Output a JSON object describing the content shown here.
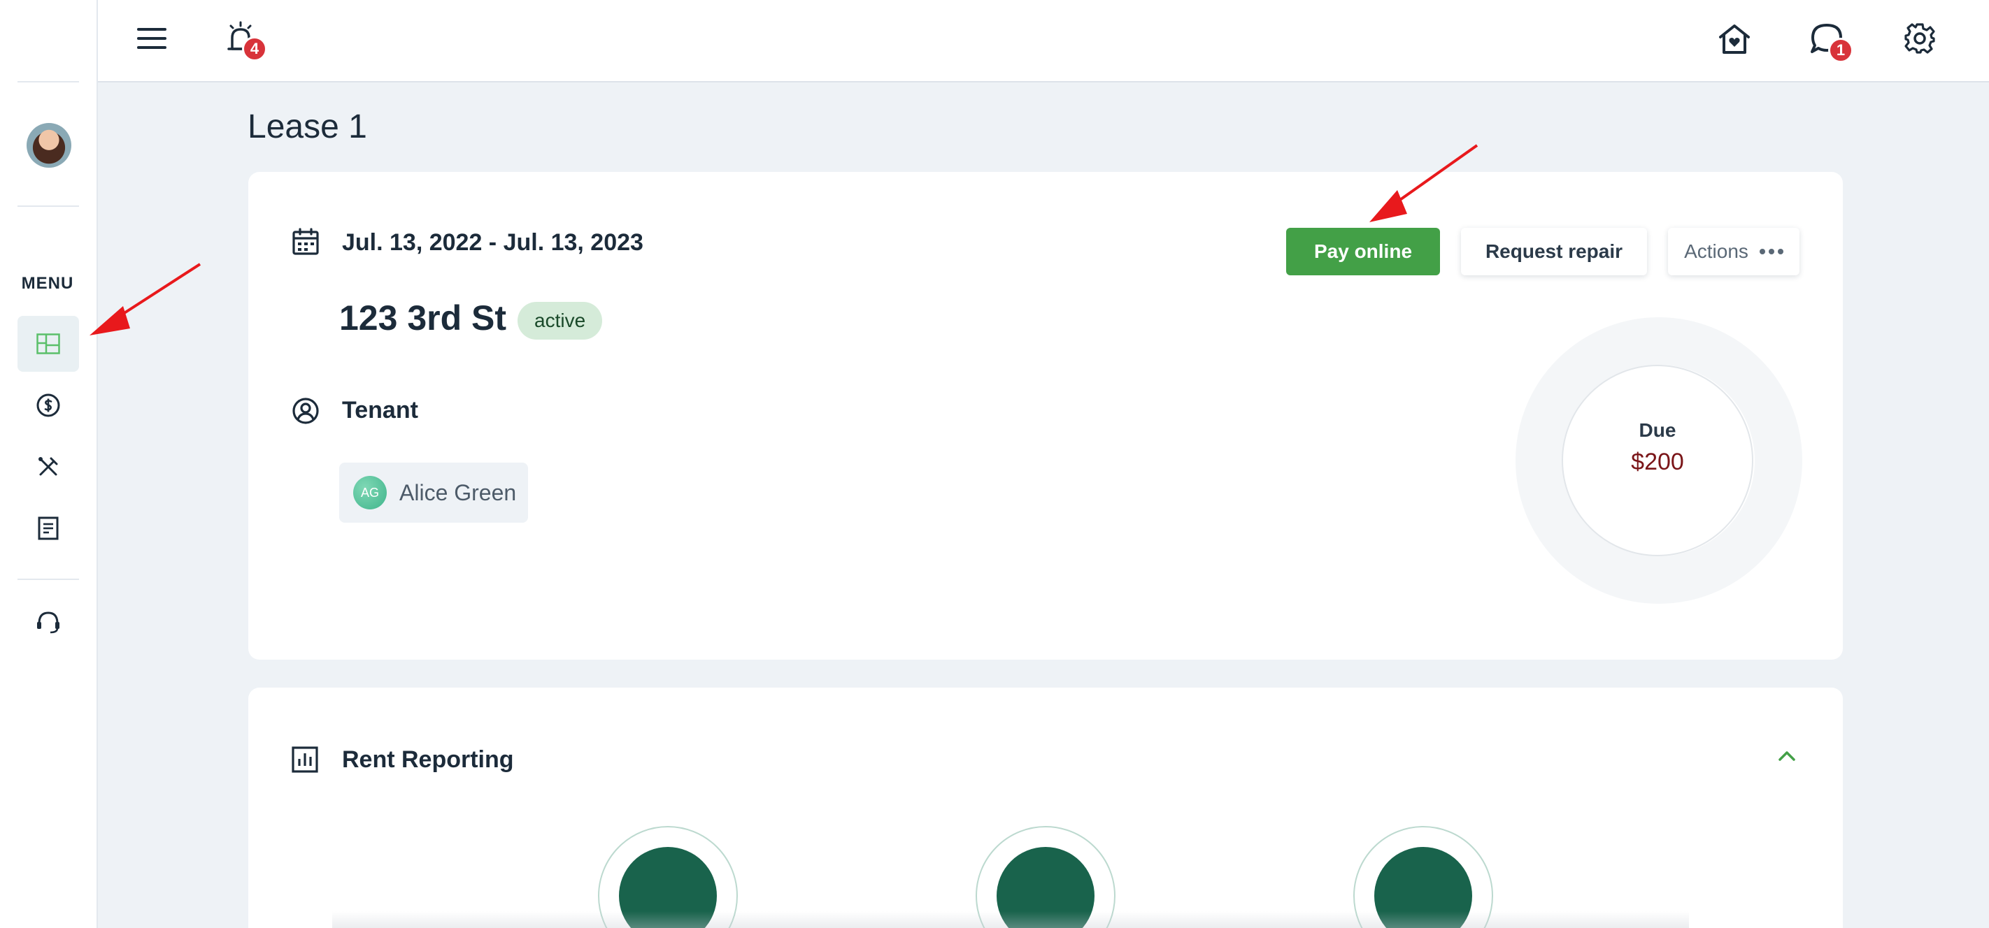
{
  "sidebar": {
    "menu_label": "MENU",
    "items": [
      {
        "icon": "dashboard-icon",
        "active": true
      },
      {
        "icon": "dollar-circle-icon",
        "active": false
      },
      {
        "icon": "tools-icon",
        "active": false
      },
      {
        "icon": "document-icon",
        "active": false
      }
    ],
    "support_icon": "headset-icon"
  },
  "topbar": {
    "alarm_badge": "4",
    "chat_badge": "1",
    "icons": [
      "menu-icon",
      "alarm-icon",
      "home-icon",
      "chat-icon",
      "settings-icon"
    ]
  },
  "page": {
    "title": "Lease 1"
  },
  "lease": {
    "dates": "Jul. 13, 2022 - Jul. 13, 2023",
    "address": "123 3rd St",
    "status": "active",
    "tenant_label": "Tenant",
    "tenant": {
      "initials": "AG",
      "name": "Alice Green"
    },
    "buttons": {
      "pay": "Pay online",
      "repair": "Request repair",
      "actions": "Actions"
    },
    "due": {
      "label": "Due",
      "amount": "$200"
    }
  },
  "rent_reporting": {
    "title": "Rent Reporting"
  },
  "colors": {
    "primary_green": "#43a047",
    "badge_red": "#d8333a",
    "due_red": "#7a1518",
    "annotation_red": "#e8191c"
  }
}
